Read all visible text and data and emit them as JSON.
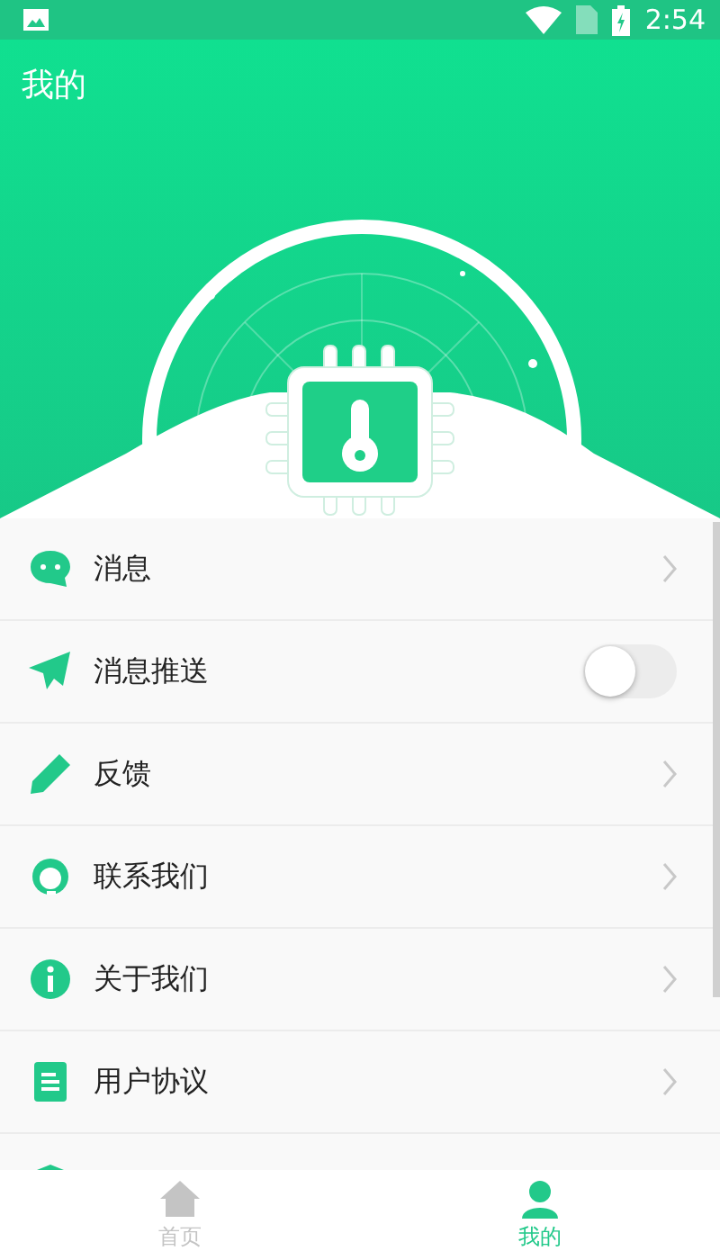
{
  "status_bar": {
    "time": "2:54"
  },
  "header": {
    "title": "我的"
  },
  "menu": [
    {
      "kind": "link",
      "label": "消息"
    },
    {
      "kind": "toggle",
      "label": "消息推送",
      "on": false
    },
    {
      "kind": "link",
      "label": "反馈"
    },
    {
      "kind": "link",
      "label": "联系我们"
    },
    {
      "kind": "link",
      "label": "关于我们"
    },
    {
      "kind": "link",
      "label": "用户协议"
    },
    {
      "kind": "link"
    }
  ],
  "tabs": [
    {
      "label": "首页",
      "selected": false
    },
    {
      "label": "我的",
      "selected": true
    }
  ]
}
